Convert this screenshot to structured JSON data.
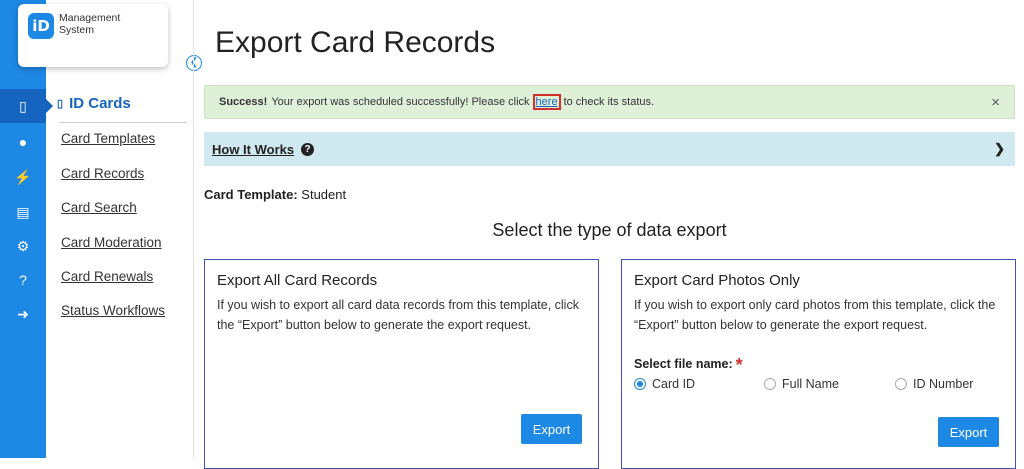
{
  "app": {
    "logo_mark": "iD",
    "logo_line1": "Management",
    "logo_line2": "System"
  },
  "rail": {
    "icons": [
      "id-card-icon",
      "chat-icon",
      "plug-icon",
      "document-icon",
      "gear-icon",
      "help-icon",
      "sign-out-icon"
    ],
    "active_index": 0
  },
  "subnav": {
    "title": "ID Cards",
    "links": [
      "Card Templates",
      "Card Records",
      "Card Search",
      "Card Moderation",
      "Card Renewals",
      "Status Workflows"
    ]
  },
  "page": {
    "title": "Export Card Records"
  },
  "alert": {
    "strong": "Success!",
    "text_before": "Your export was scheduled successfully! Please click",
    "link": "here",
    "text_after": "to check its status.",
    "close": "×"
  },
  "how_it_works": {
    "label": "How It Works",
    "help": "?",
    "chevron": "⌄"
  },
  "template": {
    "label": "Card Template:",
    "value": "Student"
  },
  "section": {
    "title": "Select the type of data export"
  },
  "cards": {
    "all": {
      "title": "Export All Card Records",
      "description": "If you wish to export all card data records from this template, click the “Export” button below to generate the export request.",
      "button": "Export"
    },
    "photos": {
      "title": "Export Card Photos Only",
      "description": "If you wish to export only card photos from this template, click the “Export” button below to generate the export request.",
      "file_name_label": "Select file name:",
      "required_mark": "*",
      "options": [
        "Card ID",
        "Full Name",
        "ID Number"
      ],
      "selected_option": "Card ID",
      "button": "Export"
    }
  },
  "colors": {
    "accent": "#1e88e5",
    "success_bg": "#dff0d8",
    "info_bg": "#d0e8f0",
    "card_border": "#3f51b5",
    "highlight": "#d32f2f"
  }
}
